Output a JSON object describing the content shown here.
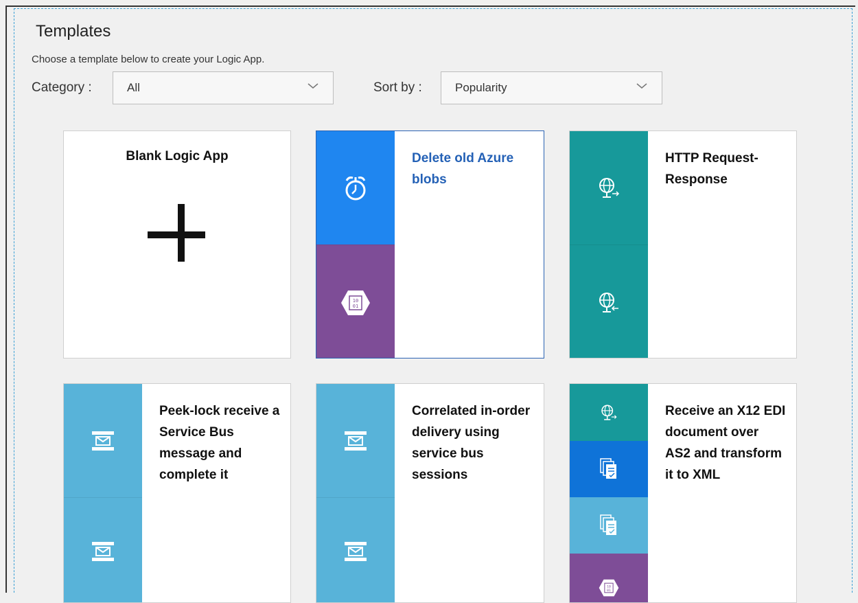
{
  "header": {
    "title": "Templates",
    "subtitle": "Choose a template below to create your Logic App."
  },
  "filters": {
    "category_label": "Category :",
    "category_value": "All",
    "sort_label": "Sort by :",
    "sort_value": "Popularity"
  },
  "templates": [
    {
      "title": "Blank Logic App",
      "icons": [
        "plus-icon"
      ]
    },
    {
      "title": "Delete old Azure blobs",
      "icons": [
        "alarm-clock-icon",
        "blob-storage-icon"
      ],
      "selected": true
    },
    {
      "title": "HTTP Request-Response",
      "icons": [
        "globe-request-icon",
        "globe-response-icon"
      ]
    },
    {
      "title": "Peek-lock receive a Service Bus message and complete it",
      "icons": [
        "service-bus-icon",
        "service-bus-icon"
      ]
    },
    {
      "title": "Correlated in-order delivery using service bus sessions",
      "icons": [
        "service-bus-icon",
        "service-bus-icon"
      ]
    },
    {
      "title": "Receive an X12 EDI document over AS2 and transform it to XML",
      "icons": [
        "globe-request-icon",
        "as2-document-icon",
        "x12-document-icon",
        "blob-storage-icon"
      ]
    }
  ],
  "colors": {
    "blue": "#1f86f0",
    "purple": "#7e4d97",
    "teal": "#17999a",
    "light_blue": "#58b3d9",
    "deep_blue": "#0f73d8",
    "selected_border": "#2b63b3",
    "title_blue": "#2461b6"
  }
}
